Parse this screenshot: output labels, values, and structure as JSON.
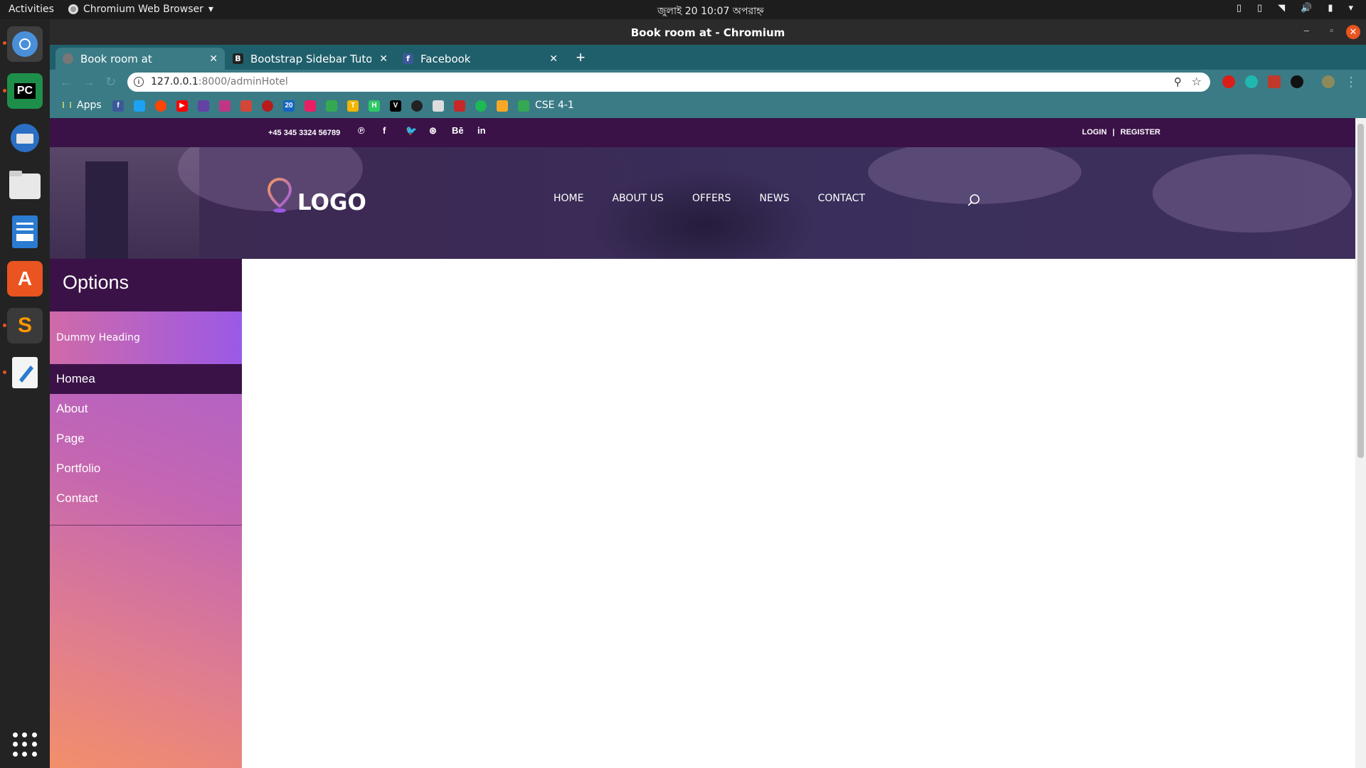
{
  "os": {
    "activities": "Activities",
    "app_menu": "Chromium Web Browser",
    "clock": "জুলাই 20  10:07 অপরাহ্ন"
  },
  "window": {
    "title": "Book room at - Chromium"
  },
  "tabs": [
    {
      "label": "Book room at",
      "favicon": "globe-icon"
    },
    {
      "label": "Bootstrap Sidebar Tutorial",
      "favicon": "bootstrap-icon"
    },
    {
      "label": "Facebook",
      "favicon": "facebook-icon"
    }
  ],
  "address_bar": {
    "host": "127.0.0.1",
    "path": ":8000/adminHotel"
  },
  "bookmarks": {
    "apps_label": "Apps",
    "folder_label": "CSE 4-1"
  },
  "site": {
    "phone": "+45 345 3324 56789",
    "social": [
      "pinterest-icon",
      "facebook-icon",
      "twitter-icon",
      "dribbble-icon",
      "behance-icon",
      "linkedin-icon"
    ],
    "social_glyphs": [
      "℗",
      "f",
      "🐦",
      "⊛",
      "Bē",
      "in"
    ],
    "login": "LOGIN",
    "separator": "|",
    "register": "REGISTER",
    "logo_text": "LOGO",
    "nav": [
      "HOME",
      "ABOUT US",
      "OFFERS",
      "NEWS",
      "CONTACT"
    ]
  },
  "sidebar": {
    "title": "Options",
    "heading": "Dummy Heading",
    "items": [
      {
        "label": "Homea",
        "active": true
      },
      {
        "label": "About",
        "active": false
      },
      {
        "label": "Page",
        "active": false
      },
      {
        "label": "Portfolio",
        "active": false
      },
      {
        "label": "Contact",
        "active": false
      }
    ]
  },
  "colors": {
    "site_header": "#3a1247",
    "chrome_toolbar": "#3b7b86",
    "sidebar_gradient_top": "#a45fd6",
    "sidebar_gradient_bottom": "#f28f6a"
  }
}
